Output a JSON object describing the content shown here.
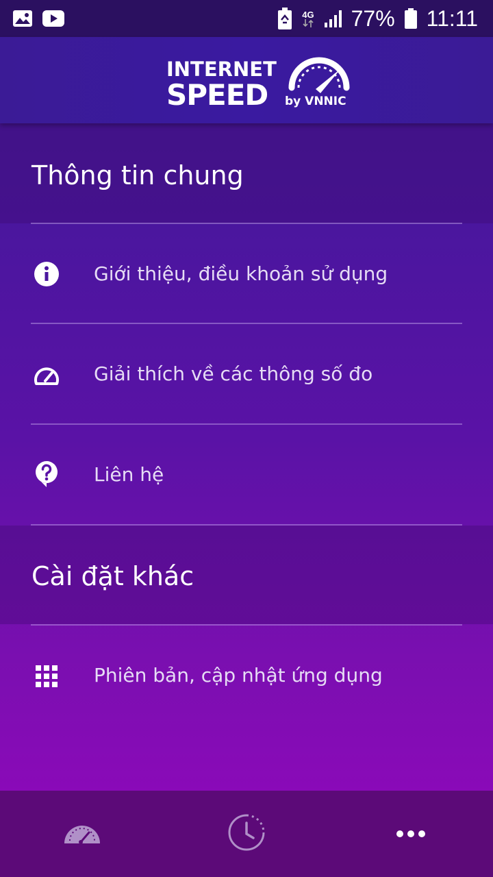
{
  "status_bar": {
    "battery_percent": "77%",
    "time": "11:11",
    "network": "4G",
    "icons": [
      "gallery-icon",
      "youtube-icon",
      "battery-saver-icon",
      "network-4g-icon",
      "signal-icon",
      "battery-icon"
    ]
  },
  "header": {
    "logo_line1": "INTERNET",
    "logo_line2": "SPEED",
    "logo_by": "by VNNIC"
  },
  "sections": {
    "general": {
      "title": "Thông tin chung",
      "items": [
        {
          "label": "Giới thiệu, điều khoản sử dụng",
          "icon": "info-icon"
        },
        {
          "label": "Giải thích về các thông số đo",
          "icon": "speedometer-icon"
        },
        {
          "label": "Liên hệ",
          "icon": "help-icon"
        }
      ]
    },
    "other": {
      "title": "Cài đặt khác",
      "items": [
        {
          "label": "Phiên bản, cập nhật ứng dụng",
          "icon": "grid-icon"
        }
      ]
    }
  },
  "bottom_nav": {
    "items": [
      {
        "icon": "gauge-icon"
      },
      {
        "icon": "history-clock-icon"
      },
      {
        "icon": "more-dots-icon"
      }
    ]
  },
  "colors": {
    "status_bar": "#2b1060",
    "header": "#3b1b96",
    "bottom_nav": "#5c0a78",
    "text_primary": "#ffffff",
    "text_menu": "#e6dcf5"
  }
}
